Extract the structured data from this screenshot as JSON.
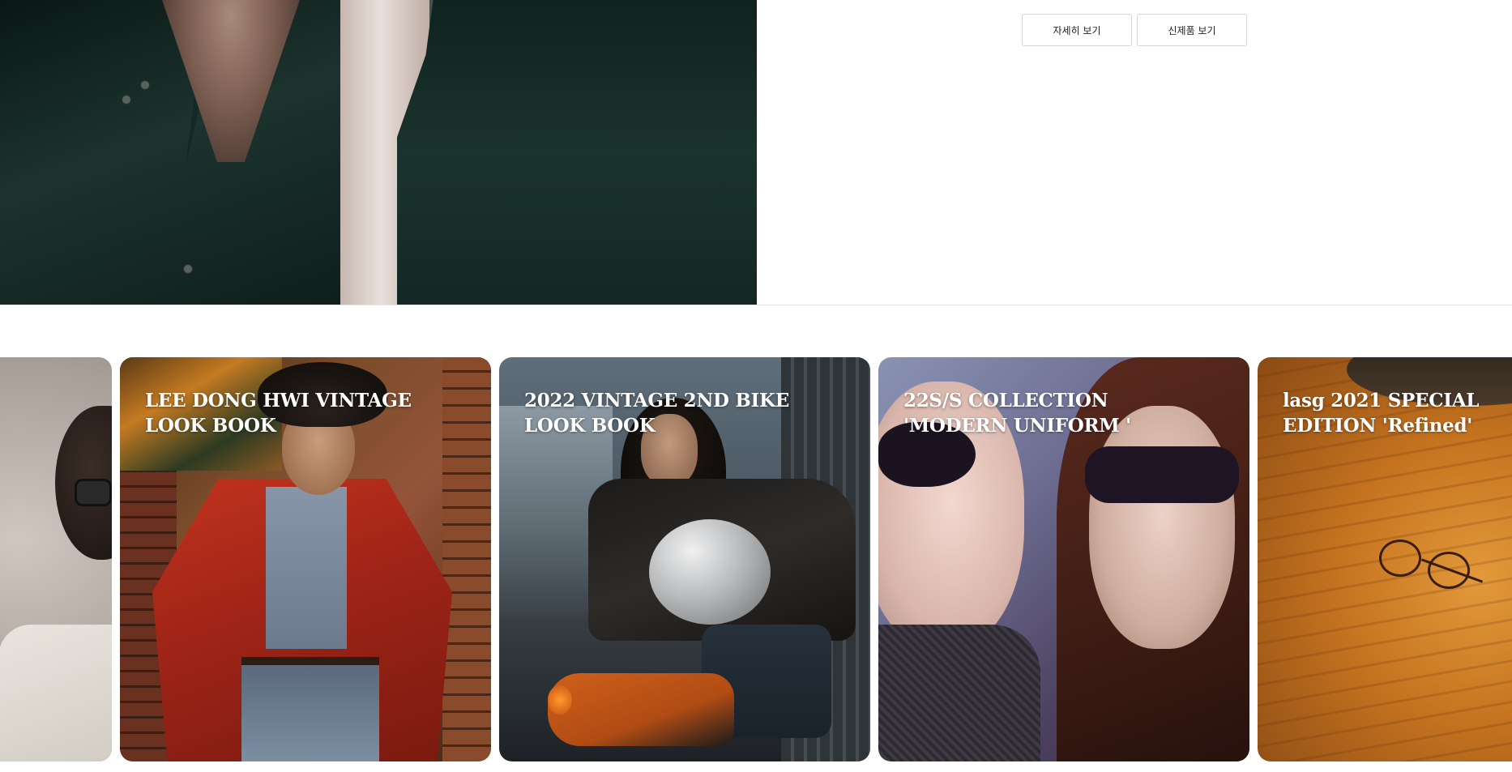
{
  "hero": {
    "buttons": {
      "details_label": "자세히 보기",
      "new_products_label": "신제품 보기"
    }
  },
  "lookbooks": [
    {
      "title": ""
    },
    {
      "title": "LEE DONG HWI VINTAGE LOOK BOOK"
    },
    {
      "title": "2022 VINTAGE 2ND BIKE LOOK BOOK"
    },
    {
      "title": "22S/S COLLECTION 'MODERN UNIFORM '"
    },
    {
      "title": "lasg 2021 SPECIAL EDITION 'Refined'"
    }
  ],
  "colors": {
    "button_border": "#d6d6d6",
    "card_title": "#ffffff",
    "divider": "#e4e4e4"
  }
}
